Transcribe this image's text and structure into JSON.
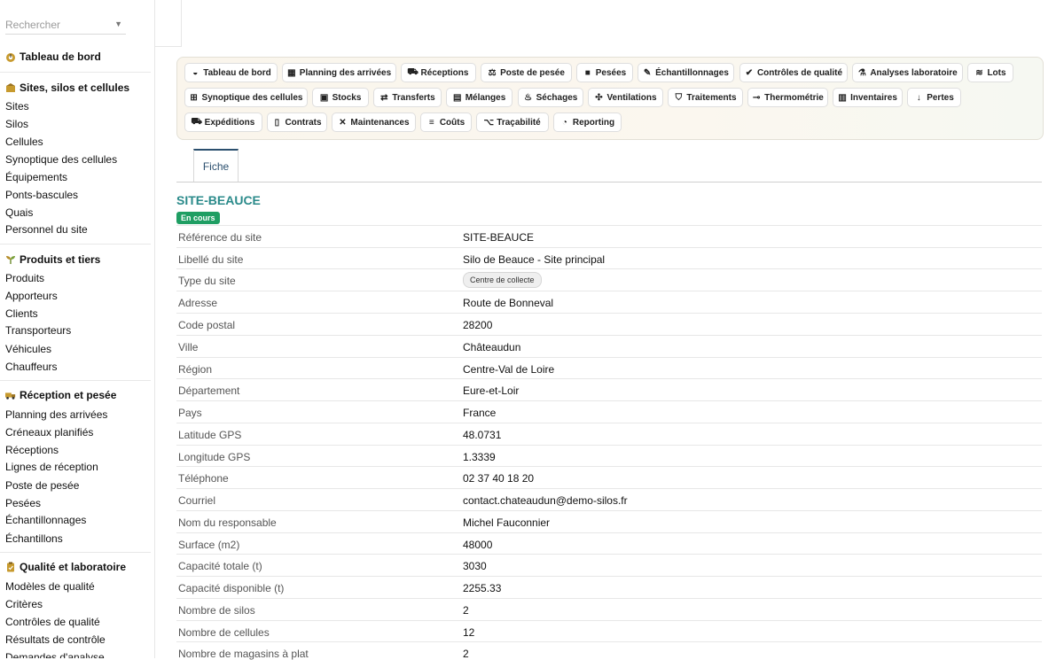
{
  "search": {
    "placeholder": "Rechercher"
  },
  "sidebar": {
    "dashboard": "Tableau de bord",
    "sections": [
      {
        "title": "Sites, silos et cellules",
        "items": [
          "Sites",
          "Silos",
          "Cellules",
          "Synoptique des cellules",
          "Équipements",
          "Ponts-bascules",
          "Quais",
          "Personnel du site"
        ]
      },
      {
        "title": "Produits et tiers",
        "items": [
          "Produits",
          "Apporteurs",
          "Clients",
          "Transporteurs",
          "Véhicules",
          "Chauffeurs"
        ]
      },
      {
        "title": "Réception et pesée",
        "items": [
          "Planning des arrivées",
          "Créneaux planifiés",
          "Réceptions",
          "Lignes de réception",
          "Poste de pesée",
          "Pesées",
          "Échantillonnages",
          "Échantillons"
        ]
      },
      {
        "title": "Qualité et laboratoire",
        "items": [
          "Modèles de qualité",
          "Critères",
          "Contrôles de qualité",
          "Résultats de contrôle",
          "Demandes d'analyse"
        ]
      }
    ]
  },
  "menu": {
    "row1": [
      "Tableau de bord",
      "Planning des arrivées",
      "Réceptions",
      "Poste de pesée",
      "Pesées",
      "Échantillonnages",
      "Contrôles de qualité",
      "Analyses laboratoire",
      "Lots"
    ],
    "row2": [
      "Synoptique des cellules",
      "Stocks",
      "Transferts",
      "Mélanges",
      "Séchages",
      "Ventilations",
      "Traitements",
      "Thermométrie",
      "Inventaires",
      "Pertes"
    ],
    "row3": [
      "Expéditions",
      "Contrats",
      "Maintenances",
      "Coûts",
      "Traçabilité",
      "Reporting"
    ]
  },
  "tabs": {
    "active": "Fiche"
  },
  "record": {
    "title": "SITE-BEAUCE",
    "status": "En cours",
    "fields": [
      {
        "label": "Référence du site",
        "value": "SITE-BEAUCE"
      },
      {
        "label": "Libellé du site",
        "value": "Silo de Beauce - Site principal"
      },
      {
        "label": "Type du site",
        "value": "Centre de collecte"
      },
      {
        "label": "Adresse",
        "value": "Route de Bonneval"
      },
      {
        "label": "Code postal",
        "value": "28200"
      },
      {
        "label": "Ville",
        "value": "Châteaudun"
      },
      {
        "label": "Région",
        "value": "Centre-Val de Loire"
      },
      {
        "label": "Département",
        "value": "Eure-et-Loir"
      },
      {
        "label": "Pays",
        "value": "France"
      },
      {
        "label": "Latitude GPS",
        "value": "48.0731"
      },
      {
        "label": "Longitude GPS",
        "value": "1.3339"
      },
      {
        "label": "Téléphone",
        "value": "02 37 40 18 20"
      },
      {
        "label": "Courriel",
        "value": "contact.chateaudun@demo-silos.fr"
      },
      {
        "label": "Nom du responsable",
        "value": "Michel Fauconnier"
      },
      {
        "label": "Surface (m2)",
        "value": "48000"
      },
      {
        "label": "Capacité totale (t)",
        "value": "3030"
      },
      {
        "label": "Capacité disponible (t)",
        "value": "2255.33"
      },
      {
        "label": "Nombre de silos",
        "value": "2"
      },
      {
        "label": "Nombre de cellules",
        "value": "12"
      },
      {
        "label": "Nombre de magasins à plat",
        "value": "2"
      }
    ]
  },
  "colors": {
    "accent": "#2a8a8a",
    "status": "#1f9e63",
    "tab": "#2b4f6e"
  }
}
